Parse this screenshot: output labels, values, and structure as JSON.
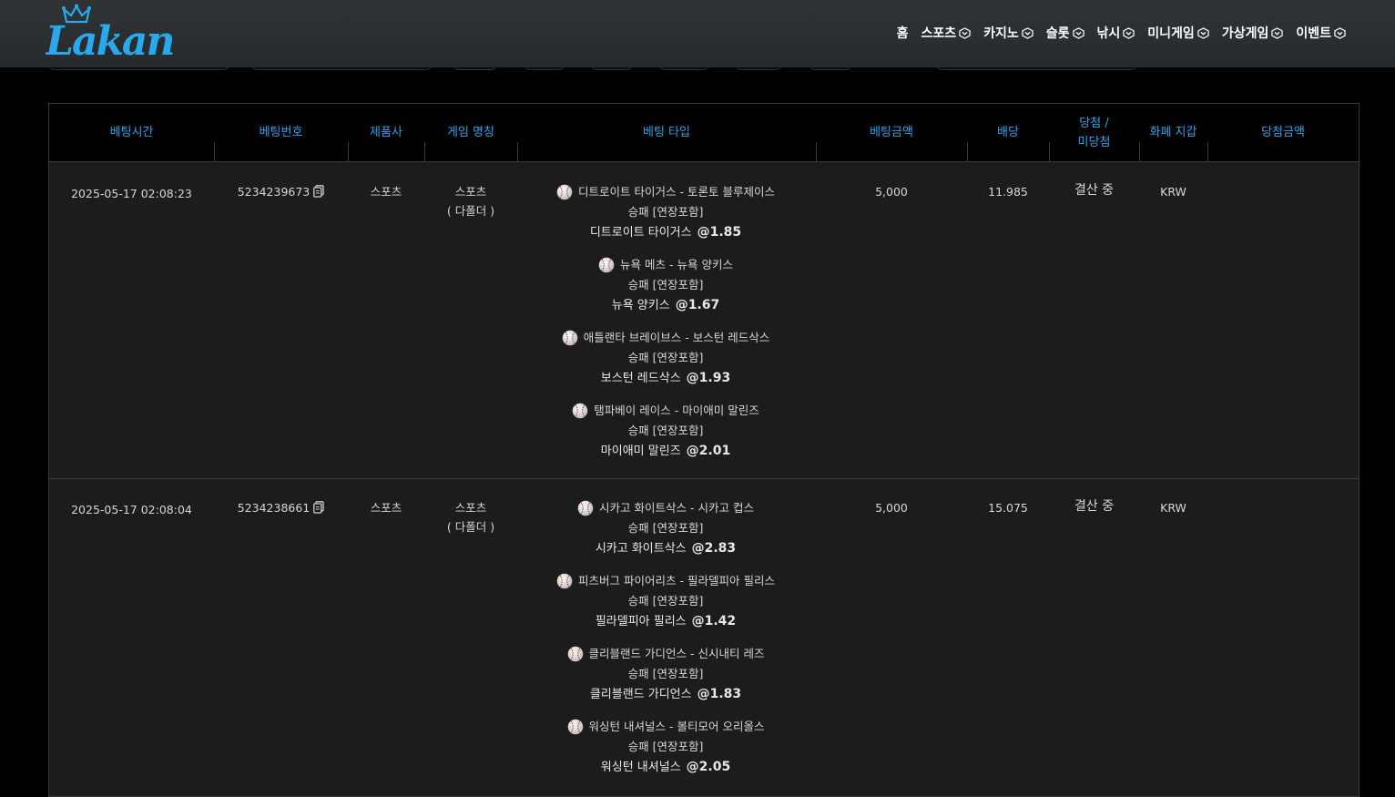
{
  "brand": {
    "logo_text": "Lakan",
    "accent": "#2ea3ee"
  },
  "nav": [
    {
      "label": "홈",
      "has_chevron": false
    },
    {
      "label": "스포츠",
      "has_chevron": true
    },
    {
      "label": "카지노",
      "has_chevron": true
    },
    {
      "label": "슬롯",
      "has_chevron": true
    },
    {
      "label": "낚시",
      "has_chevron": true
    },
    {
      "label": "미니게임",
      "has_chevron": true
    },
    {
      "label": "가상게임",
      "has_chevron": true
    },
    {
      "label": "이벤트",
      "has_chevron": true
    }
  ],
  "table": {
    "headers": [
      "베팅시간",
      "베팅번호",
      "제품사",
      "게임 명칭",
      "베팅 타입",
      "베팅금액",
      "배당",
      "당첨 / 미당첨",
      "화폐 지갑",
      "당첨금액"
    ],
    "header_status_line1": "당첨 /",
    "header_status_line2": "미당첨",
    "rows": [
      {
        "time": "2025-05-17 02:08:23",
        "bet_no": "5234239673",
        "provider": "스포츠",
        "game": "스포츠",
        "game_sub": "( 다폴더 )",
        "amount": "5,000",
        "odds": "11.985",
        "status": "결산 중",
        "currency": "KRW",
        "win_amount": "",
        "legs": [
          {
            "match": "디트로이트 타이거스 - 토론토 블루제이스",
            "type": "승패 [연장포함]",
            "pick": "디트로이트 타이거스",
            "odds": "@1.85"
          },
          {
            "match": "뉴욕 메츠 - 뉴욕 양키스",
            "type": "승패 [연장포함]",
            "pick": "뉴욕 양키스",
            "odds": "@1.67"
          },
          {
            "match": "애틀랜타 브레이브스 - 보스턴 레드삭스",
            "type": "승패 [연장포함]",
            "pick": "보스턴 레드삭스",
            "odds": "@1.93"
          },
          {
            "match": "탬파베이 레이스 - 마이애미 말린즈",
            "type": "승패 [연장포함]",
            "pick": "마이애미 말린즈",
            "odds": "@2.01"
          }
        ]
      },
      {
        "time": "2025-05-17 02:08:04",
        "bet_no": "5234238661",
        "provider": "스포츠",
        "game": "스포츠",
        "game_sub": "( 다폴더 )",
        "amount": "5,000",
        "odds": "15.075",
        "status": "결산 중",
        "currency": "KRW",
        "win_amount": "",
        "legs": [
          {
            "match": "시카고 화이트삭스 - 시카고 컵스",
            "type": "승패 [연장포함]",
            "pick": "시카고 화이트삭스",
            "odds": "@2.83"
          },
          {
            "match": "피츠버그 파이어리츠 - 필라델피아 필리스",
            "type": "승패 [연장포함]",
            "pick": "필라델피아 필리스",
            "odds": "@1.42"
          },
          {
            "match": "클리블랜드 가디언스 - 신시내티 레즈",
            "type": "승패 [연장포함]",
            "pick": "클리블랜드 가디언스",
            "odds": "@1.83"
          },
          {
            "match": "워싱턴 내셔널스 - 볼티모어 오리올스",
            "type": "승패 [연장포함]",
            "pick": "워싱턴 내셔널스",
            "odds": "@2.05"
          }
        ]
      }
    ]
  }
}
